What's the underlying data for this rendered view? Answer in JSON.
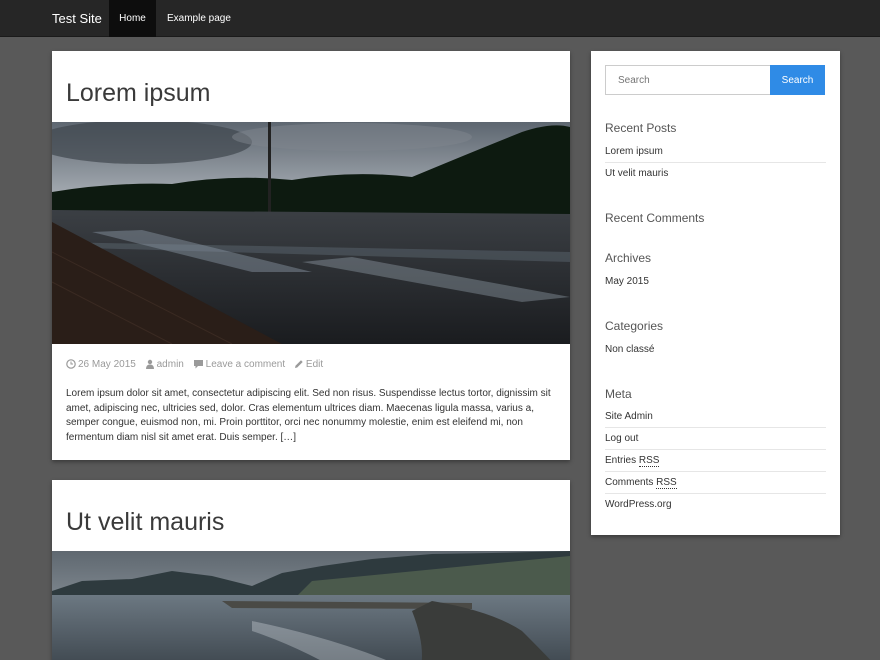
{
  "navbar": {
    "brand": "Test Site",
    "items": [
      {
        "label": "Home",
        "active": true
      },
      {
        "label": "Example page",
        "active": false
      }
    ]
  },
  "posts": [
    {
      "title": "Lorem ipsum",
      "image": "photo of a wet street at dusk",
      "date": "26 May 2015",
      "author": "admin",
      "comments": "Leave a comment",
      "edit": "Edit",
      "excerpt": "Lorem ipsum dolor sit amet, consectetur adipiscing elit. Sed non risus. Suspendisse lectus tortor, dignissim sit amet, adipiscing nec, ultricies sed, dolor. Cras elementum ultrices diam. Maecenas ligula massa, varius a, semper congue, euismod non, mi. Proin porttitor, orci nec nonummy molestie, enim est eleifend mi, non fermentum diam nisl sit amet erat. Duis semper.",
      "more": "[…]"
    },
    {
      "title": "Ut velit mauris",
      "image": "photo of a lake shore with mountains"
    }
  ],
  "sidebar": {
    "search": {
      "placeholder": "Search",
      "button": "Search"
    },
    "recent_posts": {
      "title": "Recent Posts",
      "items": [
        "Lorem ipsum",
        "Ut velit mauris"
      ]
    },
    "recent_comments": {
      "title": "Recent Comments"
    },
    "archives": {
      "title": "Archives",
      "items": [
        "May 2015"
      ]
    },
    "categories": {
      "title": "Categories",
      "items": [
        "Non classé"
      ]
    },
    "meta": {
      "title": "Meta",
      "items": [
        "Site Admin",
        "Log out",
        "Entries",
        "Comments",
        "WordPress.org"
      ],
      "rss": "RSS"
    }
  },
  "colors": {
    "background": "#595959",
    "navbar": "#262626",
    "accent": "#2f8be6"
  },
  "icons": [
    "clock-icon",
    "user-icon",
    "comment-icon",
    "pencil-icon"
  ]
}
